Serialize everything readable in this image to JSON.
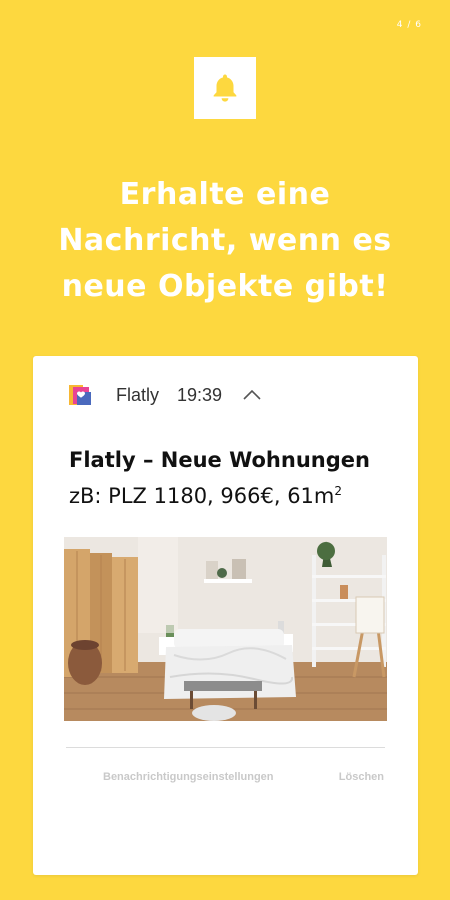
{
  "page_indicator": "4 / 6",
  "headline": {
    "line1": "Erhalte eine",
    "line2": "Nachricht, wenn es",
    "line3": "neue Objekte gibt!"
  },
  "notification": {
    "app_name": "Flatly",
    "time": "19:39",
    "title": "Flatly – Neue Wohnungen",
    "body": "zB: PLZ 1180, 966€, 61m",
    "body_superscript": "2",
    "settings_label": "Benachrichtigungseinstellungen",
    "delete_label": "Löschen"
  },
  "colors": {
    "background": "#fdd83f",
    "card": "#ffffff",
    "action_text": "#c9c9c9"
  },
  "icons": {
    "top": "bell-icon",
    "app": "flatly-app-icon",
    "expand": "chevron-up-icon"
  }
}
